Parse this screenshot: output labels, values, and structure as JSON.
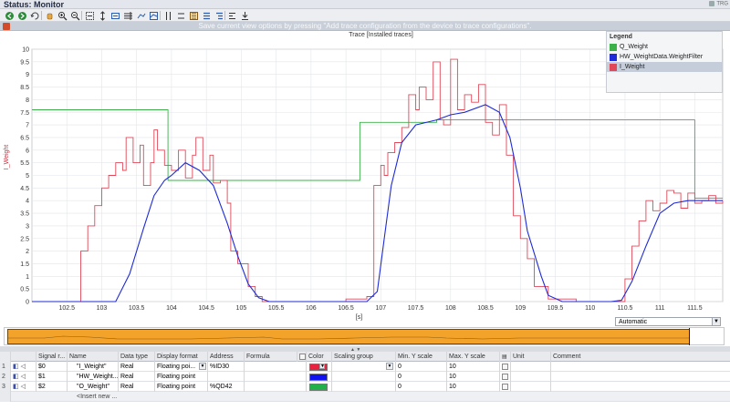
{
  "status": {
    "title": "Status: Monitor",
    "right_indicator": "TRG"
  },
  "toolbar": {
    "buttons": [
      {
        "icon": "nav-back-icon"
      },
      {
        "icon": "nav-forward-icon"
      },
      {
        "icon": "undo-zoom-icon"
      },
      {
        "icon": "hand-pan-icon"
      },
      {
        "icon": "zoom-in-icon"
      },
      {
        "icon": "zoom-out-icon"
      },
      {
        "icon": "zoom-fit-icon"
      },
      {
        "icon": "zoom-vertical-icon"
      },
      {
        "icon": "zoom-horizontal-icon"
      },
      {
        "icon": "scale-icon"
      },
      {
        "icon": "move-left-icon"
      },
      {
        "icon": "grid-icon"
      },
      {
        "icon": "measure-cursor-icon"
      },
      {
        "icon": "cursor-vertical-icon"
      },
      {
        "icon": "cursor-horizontal-icon"
      },
      {
        "icon": "legend-icon"
      },
      {
        "icon": "list-icon"
      },
      {
        "icon": "list-detail-icon"
      },
      {
        "icon": "export-icon"
      }
    ]
  },
  "hint": {
    "text": "Save current view options by pressing \"Add trace configuration from the device to trace configurations\"."
  },
  "chart_data": {
    "type": "line",
    "title": "Trace [Installed traces]",
    "xlabel": "[s]",
    "ylabel": "I_Weight",
    "xlim": [
      102.0,
      111.9
    ],
    "ylim": [
      0,
      10
    ],
    "xticks": [
      "102.5",
      "103",
      "103.5",
      "104",
      "104.5",
      "105",
      "105.5",
      "106",
      "106.5",
      "107",
      "107.5",
      "108",
      "108.5",
      "109",
      "109.5",
      "110",
      "110.5",
      "111",
      "111.5"
    ],
    "yticks": [
      "0",
      "0.5",
      "1",
      "1.5",
      "2",
      "2.5",
      "3",
      "3.5",
      "4",
      "4.5",
      "5",
      "5.5",
      "6",
      "6.5",
      "7",
      "7.5",
      "8",
      "8.5",
      "9",
      "9.5",
      "10"
    ],
    "grid": true,
    "legend_position": "top-right",
    "series": [
      {
        "name": "Q_Weight",
        "color": "#3cb14a",
        "x": [
          102.0,
          103.95,
          103.95,
          106.7,
          106.7,
          107.8,
          107.8,
          111.5,
          111.5,
          111.9
        ],
        "y": [
          7.6,
          7.6,
          4.8,
          4.8,
          7.1,
          7.1,
          7.2,
          7.2,
          4.1,
          4.1
        ]
      },
      {
        "name": "HW_WeightData.WeightFilter",
        "color": "#1f2bd6",
        "x": [
          102.0,
          103.2,
          103.4,
          103.6,
          103.75,
          103.9,
          104.0,
          104.2,
          104.4,
          104.6,
          104.8,
          104.95,
          105.1,
          105.25,
          105.4,
          105.6,
          106.0,
          106.5,
          106.8,
          106.95,
          107.05,
          107.15,
          107.3,
          107.5,
          107.8,
          108.0,
          108.2,
          108.5,
          108.7,
          108.85,
          109.0,
          109.1,
          109.3,
          109.4,
          109.6,
          110.0,
          110.3,
          110.45,
          110.6,
          110.8,
          111.0,
          111.2,
          111.4,
          111.6,
          111.9
        ],
        "y": [
          0,
          0,
          1.1,
          2.9,
          4.2,
          4.8,
          5.0,
          5.5,
          5.2,
          4.6,
          3.1,
          1.8,
          0.7,
          0.15,
          0,
          0,
          0,
          0,
          0,
          0.4,
          2.5,
          4.6,
          6.3,
          7.0,
          7.2,
          7.4,
          7.5,
          7.8,
          7.5,
          6.5,
          4.5,
          2.8,
          1.0,
          0.25,
          0,
          0,
          0,
          0.05,
          0.8,
          2.2,
          3.5,
          3.9,
          4.0,
          4.0,
          4.0
        ]
      },
      {
        "name": "I_Weight",
        "color": "#e04858",
        "x": [
          102.0,
          102.6,
          102.7,
          102.8,
          102.9,
          103.0,
          103.1,
          103.2,
          103.3,
          103.35,
          103.45,
          103.55,
          103.6,
          103.7,
          103.75,
          103.8,
          103.9,
          104.0,
          104.1,
          104.2,
          104.3,
          104.35,
          104.45,
          104.55,
          104.6,
          104.7,
          104.8,
          104.85,
          104.95,
          105.1,
          105.2,
          105.3,
          105.5,
          106.0,
          106.5,
          106.8,
          106.9,
          107.0,
          107.05,
          107.1,
          107.2,
          107.3,
          107.4,
          107.5,
          107.55,
          107.65,
          107.75,
          107.85,
          107.9,
          108.0,
          108.1,
          108.2,
          108.3,
          108.4,
          108.5,
          108.6,
          108.7,
          108.8,
          108.9,
          109.0,
          109.1,
          109.2,
          109.4,
          109.8,
          110.3,
          110.5,
          110.6,
          110.7,
          110.8,
          110.9,
          111.0,
          111.1,
          111.2,
          111.3,
          111.4,
          111.5,
          111.6,
          111.7,
          111.8,
          111.9
        ],
        "y": [
          0,
          0,
          2.0,
          3.0,
          3.8,
          4.5,
          5.0,
          5.5,
          5.2,
          6.5,
          5.5,
          6.2,
          4.6,
          5.5,
          6.8,
          6.0,
          5.4,
          5.2,
          6.0,
          4.9,
          5.8,
          6.5,
          5.2,
          5.8,
          4.7,
          4.8,
          3.9,
          2.0,
          1.5,
          0.6,
          0.2,
          0,
          0,
          0,
          0.1,
          0.2,
          4.6,
          5.4,
          5.0,
          5.9,
          6.3,
          6.9,
          8.2,
          7.6,
          8.5,
          8.0,
          9.5,
          7.2,
          7.0,
          9.6,
          7.6,
          8.2,
          7.9,
          8.6,
          7.1,
          6.6,
          7.8,
          5.8,
          3.4,
          2.5,
          1.7,
          0.6,
          0.1,
          0,
          0,
          0.9,
          2.2,
          3.2,
          4.0,
          3.6,
          3.9,
          4.4,
          4.3,
          3.7,
          4.3,
          3.9,
          4.0,
          4.2,
          3.9,
          4.0
        ]
      }
    ]
  },
  "legend": {
    "title": "Legend",
    "items": [
      {
        "label": "Q_Weight",
        "color": "#3cb14a"
      },
      {
        "label": "HW_WeightData.WeightFilter",
        "color": "#1f2bd6"
      },
      {
        "label": "I_Weight",
        "color": "#e04858"
      }
    ]
  },
  "scaling": {
    "selected": "Automatic"
  },
  "signal_table": {
    "headers": [
      "Signal r...",
      "Name",
      "Data type",
      "Display format",
      "Address",
      "Formula",
      "Color",
      "Scaling group",
      "Min. Y scale",
      "Max. Y scale",
      "",
      "Unit",
      "Comment"
    ],
    "rows": [
      {
        "num": "1",
        "signal": "$0",
        "name": "\"I_Weight\"",
        "type": "Real",
        "format": "Floating poi...",
        "address": "%ID30",
        "formula": "",
        "color": "#e8233f",
        "group": "",
        "min": "0",
        "max": "10",
        "unit": "",
        "comment": ""
      },
      {
        "num": "2",
        "signal": "$1",
        "name": "\"HW_Weight...\"",
        "type": "Real",
        "format": "Floating point",
        "address": "",
        "formula": "",
        "color": "#1212ee",
        "group": "",
        "min": "0",
        "max": "10",
        "unit": "",
        "comment": ""
      },
      {
        "num": "3",
        "signal": "$2",
        "name": "\"O_Weight\"",
        "type": "Real",
        "format": "Floating point",
        "address": "%QD42",
        "formula": "",
        "color": "#22b04a",
        "group": "",
        "min": "0",
        "max": "10",
        "unit": "",
        "comment": ""
      }
    ],
    "insert_label": "<Insert new ..."
  }
}
